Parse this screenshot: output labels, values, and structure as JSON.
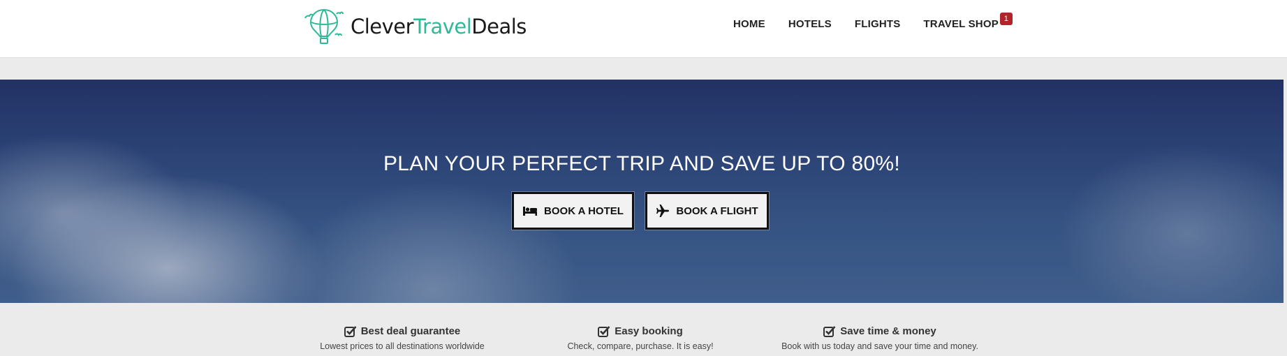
{
  "brand": {
    "part1": "Clever",
    "part2": "Travel",
    "part3": "Deals",
    "accent_color": "#2fb996",
    "icon": "hot-air-balloon-icon"
  },
  "nav": {
    "items": [
      {
        "label": "HOME"
      },
      {
        "label": "HOTELS"
      },
      {
        "label": "FLIGHTS"
      },
      {
        "label": "TRAVEL SHOP",
        "badge": "1"
      }
    ],
    "badge_color": "#b3242a"
  },
  "hero": {
    "title": "PLAN YOUR PERFECT TRIP AND SAVE UP TO 80%!",
    "buttons": [
      {
        "label": "BOOK A HOTEL",
        "icon": "bed-icon"
      },
      {
        "label": "BOOK A FLIGHT",
        "icon": "plane-icon"
      }
    ]
  },
  "features": [
    {
      "title": "Best deal guarantee",
      "desc": "Lowest prices to all destinations worldwide",
      "icon": "checkbox-icon"
    },
    {
      "title": "Easy booking",
      "desc": "Check, compare, purchase. It is easy!",
      "icon": "checkbox-icon"
    },
    {
      "title": "Save time & money",
      "desc": "Book with us today and save your time and money.",
      "icon": "checkbox-icon"
    }
  ]
}
